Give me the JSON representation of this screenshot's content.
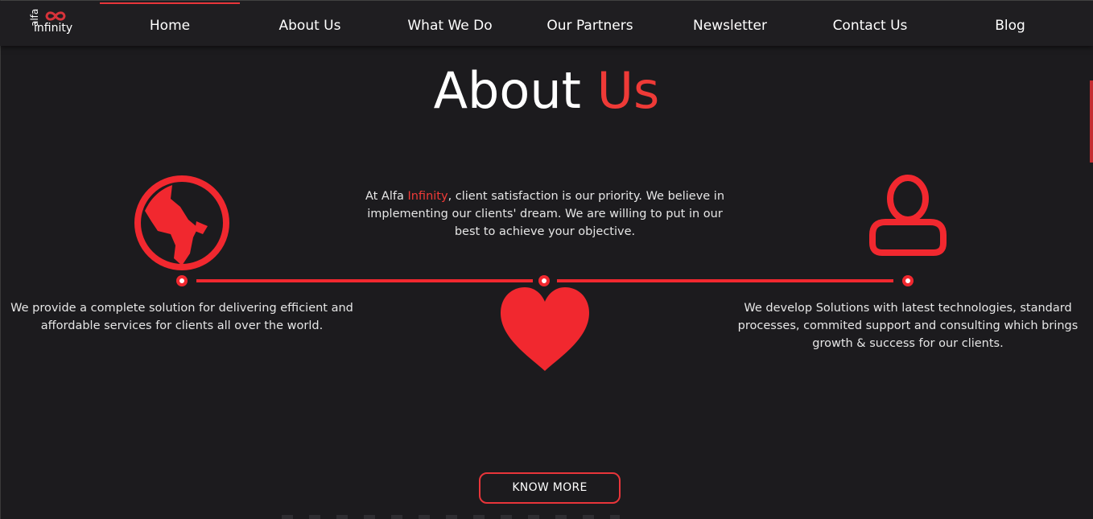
{
  "brand": {
    "logo_top": "alfa",
    "logo_bottom": "infinity",
    "accent_color": "#ef3a37",
    "background_color": "#1c1b1e"
  },
  "nav": {
    "items": [
      {
        "label": "Home",
        "active": true
      },
      {
        "label": "About Us",
        "active": false
      },
      {
        "label": "What We Do",
        "active": false
      },
      {
        "label": "Our Partners",
        "active": false
      },
      {
        "label": "Newsletter",
        "active": false
      },
      {
        "label": "Contact Us",
        "active": false
      },
      {
        "label": "Blog",
        "active": false
      }
    ]
  },
  "section": {
    "title_main": "About",
    "title_accent": "Us",
    "intro": {
      "before": "At Alfa ",
      "accent": "Infinity",
      "after": ", client satisfaction is our priority. We believe in implementing our clients' dream. We are willing to put in our best to achieve your objective."
    },
    "left_text": "We provide a complete solution for delivering efficient and affordable services for clients all over the world.",
    "right_text": "We develop Solutions with latest technologies, standard processes, commited support and consulting which brings growth & success for our clients.",
    "icons": {
      "left": "globe-icon",
      "center": "heart-icon",
      "right": "user-icon"
    },
    "button_label": "KNOW MORE"
  }
}
